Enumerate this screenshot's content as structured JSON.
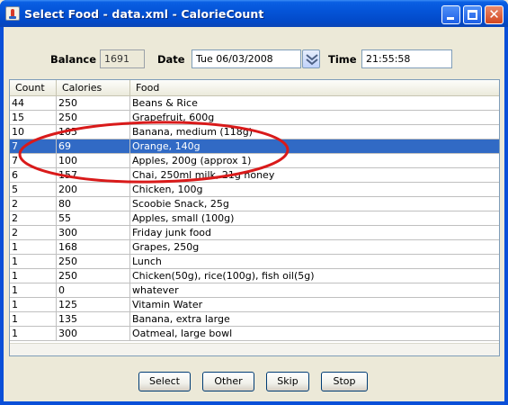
{
  "window": {
    "title": "Select Food - data.xml - CalorieCount",
    "close_glyph": "✕"
  },
  "header": {
    "balance_label": "Balance",
    "balance_value": "1691",
    "date_label": "Date",
    "date_value": "Tue 06/03/2008",
    "time_label": "Time",
    "time_value": "21:55:58"
  },
  "table": {
    "columns": [
      "Count",
      "Calories",
      "Food"
    ],
    "rows": [
      {
        "count": "44",
        "calories": "250",
        "food": "Beans & Rice"
      },
      {
        "count": "15",
        "calories": "250",
        "food": "Grapefruit, 600g"
      },
      {
        "count": "10",
        "calories": "105",
        "food": "Banana, medium (118g)"
      },
      {
        "count": "7",
        "calories": "69",
        "food": "Orange, 140g"
      },
      {
        "count": "7",
        "calories": "100",
        "food": "Apples, 200g (approx 1)"
      },
      {
        "count": "6",
        "calories": "157",
        "food": "Chai, 250ml milk, 21g honey"
      },
      {
        "count": "5",
        "calories": "200",
        "food": "Chicken, 100g"
      },
      {
        "count": "2",
        "calories": "80",
        "food": "Scoobie Snack, 25g"
      },
      {
        "count": "2",
        "calories": "55",
        "food": "Apples, small (100g)"
      },
      {
        "count": "2",
        "calories": "300",
        "food": "Friday junk food"
      },
      {
        "count": "1",
        "calories": "168",
        "food": "Grapes, 250g"
      },
      {
        "count": "1",
        "calories": "250",
        "food": "Lunch"
      },
      {
        "count": "1",
        "calories": "250",
        "food": "Chicken(50g), rice(100g), fish oil(5g)"
      },
      {
        "count": "1",
        "calories": "0",
        "food": "whatever"
      },
      {
        "count": "1",
        "calories": "125",
        "food": "Vitamin Water"
      },
      {
        "count": "1",
        "calories": "135",
        "food": "Banana, extra large"
      },
      {
        "count": "1",
        "calories": "300",
        "food": "Oatmeal, large bowl"
      }
    ],
    "selected_index": 3
  },
  "buttons": {
    "select": "Select",
    "other": "Other",
    "skip": "Skip",
    "stop": "Stop"
  },
  "colors": {
    "selection": "#316ac5",
    "annotation": "#d91a1a",
    "titlebar": "#0454d8"
  }
}
